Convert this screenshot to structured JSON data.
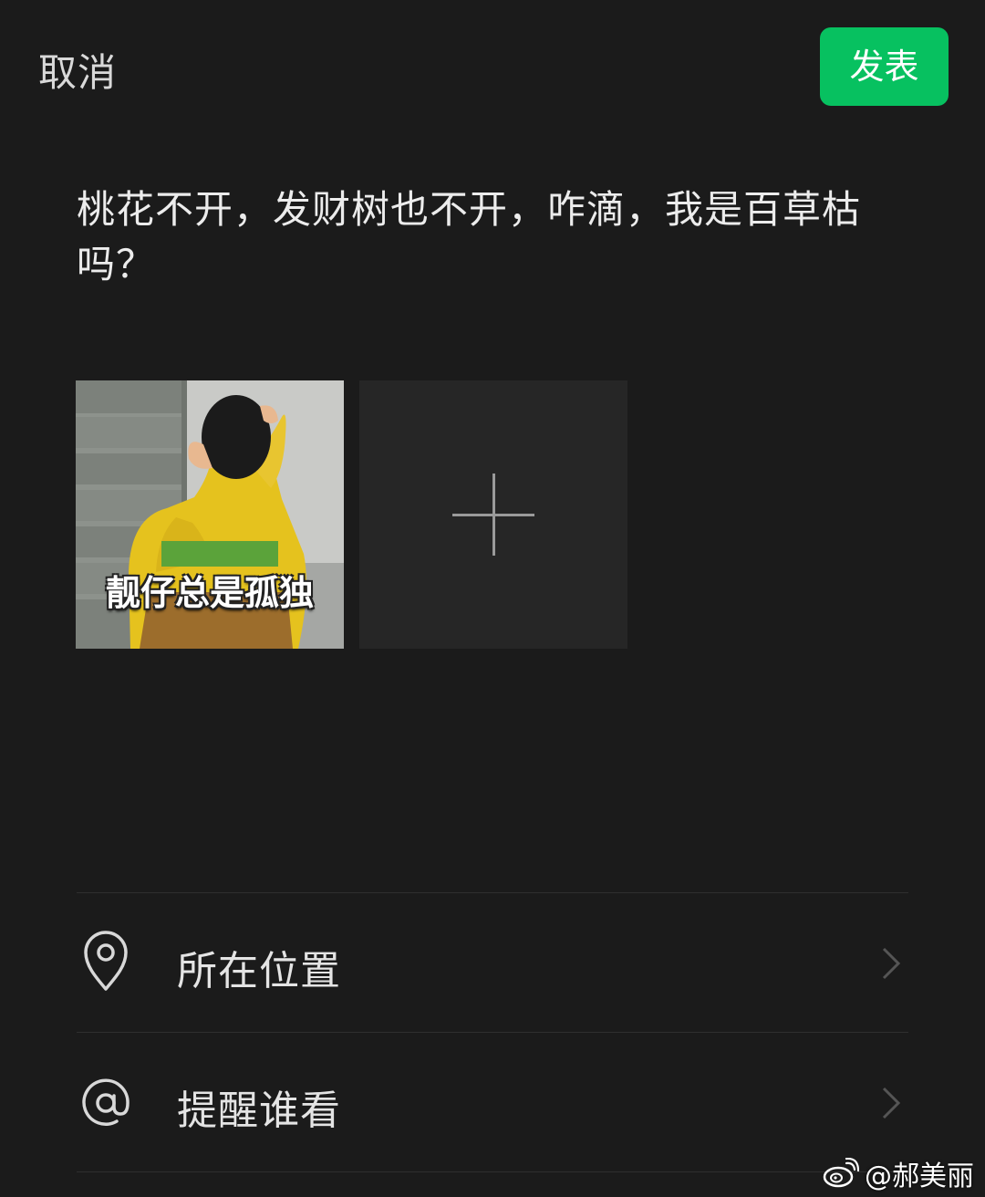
{
  "header": {
    "cancel_label": "取消",
    "publish_label": "发表"
  },
  "post": {
    "text": "桃花不开，发财树也不开，咋滴，我是百草枯吗？"
  },
  "media": {
    "thumbnail_caption": "靓仔总是孤独"
  },
  "options": {
    "location_label": "所在位置",
    "mention_label": "提醒谁看"
  },
  "watermark": {
    "text": "@郝美丽"
  },
  "colors": {
    "background": "#1b1b1b",
    "accent": "#07c160"
  }
}
